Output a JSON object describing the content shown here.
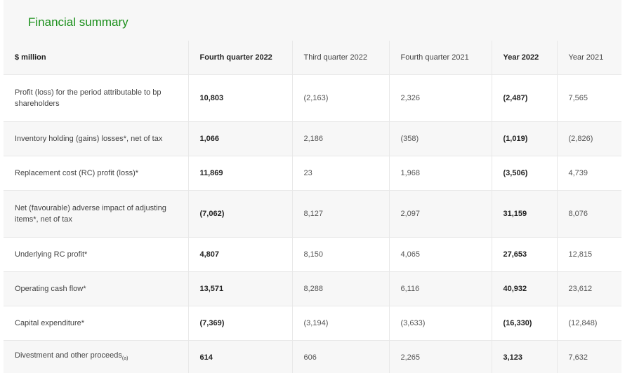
{
  "title": "Financial summary",
  "header": {
    "label": "$ million",
    "columns": [
      "Fourth quarter 2022",
      "Third quarter 2022",
      "Fourth quarter 2021",
      "Year 2022",
      "Year 2021"
    ]
  },
  "rows": [
    {
      "label": "Profit (loss) for the period attributable to bp shareholders",
      "values": [
        "10,803",
        "(2,163)",
        "2,326",
        "(2,487)",
        "7,565"
      ]
    },
    {
      "label": "Inventory holding (gains) losses*, net of tax",
      "values": [
        "1,066",
        "2,186",
        "(358)",
        "(1,019)",
        "(2,826)"
      ]
    },
    {
      "label": "Replacement cost (RC) profit (loss)*",
      "values": [
        "11,869",
        "23",
        "1,968",
        "(3,506)",
        "4,739"
      ]
    },
    {
      "label": "Net (favourable) adverse impact of adjusting items*, net of tax",
      "values": [
        "(7,062)",
        "8,127",
        "2,097",
        "31,159",
        "8,076"
      ]
    },
    {
      "label": "Underlying RC profit*",
      "values": [
        "4,807",
        "8,150",
        "4,065",
        "27,653",
        "12,815"
      ]
    },
    {
      "label": "Operating cash flow*",
      "values": [
        "13,571",
        "8,288",
        "6,116",
        "40,932",
        "23,612"
      ]
    },
    {
      "label": "Capital expenditure*",
      "values": [
        "(7,369)",
        "(3,194)",
        "(3,633)",
        "(16,330)",
        "(12,848)"
      ]
    },
    {
      "label": "Divestment and other proceeds",
      "label_sub": "(a)",
      "values": [
        "614",
        "606",
        "2,265",
        "3,123",
        "7,632"
      ]
    }
  ]
}
